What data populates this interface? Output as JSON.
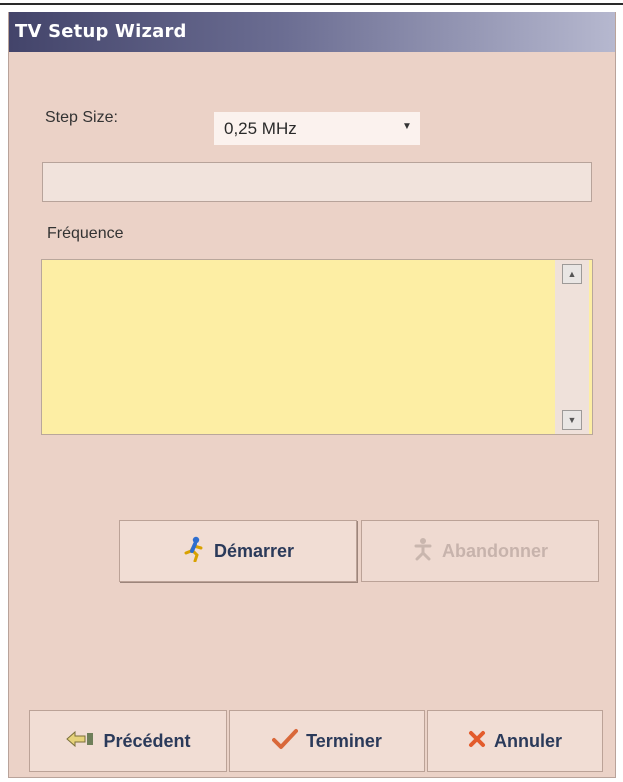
{
  "window": {
    "title": "TV Setup Wizard"
  },
  "step_size": {
    "label": "Step Size:",
    "value": "0,25 MHz"
  },
  "frequency": {
    "label": "Fréquence"
  },
  "actions": {
    "start_label": "Démarrer",
    "abort_label": "Abandonner"
  },
  "footer": {
    "previous_label": "Précédent",
    "finish_label": "Terminer",
    "cancel_label": "Annuler"
  },
  "icons": {
    "start": "running-person-icon",
    "abort": "stop-person-icon",
    "previous": "back-arrow-icon",
    "finish": "checkmark-icon",
    "cancel": "cross-icon"
  },
  "colors": {
    "window_bg": "#ebd2c7",
    "list_bg": "#fdeea4",
    "title_gradient_start": "#43446a",
    "title_gradient_end": "#b6b8cf"
  }
}
